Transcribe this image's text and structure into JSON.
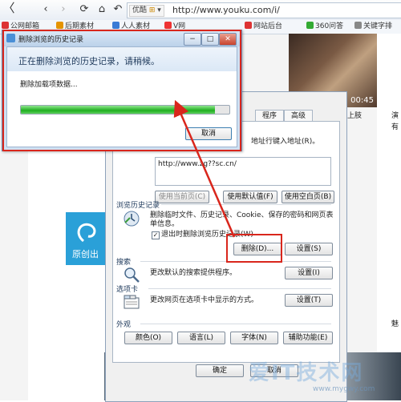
{
  "browser": {
    "youku_label": "优酷",
    "youku_icon": "grid-icon",
    "url": "http://www.youku.com/i/",
    "bookmarks": [
      "公网邮箱",
      "后期素材",
      "人人素材",
      "V网",
      "网站后台",
      "360问答",
      "关键字排"
    ]
  },
  "page": {
    "tile_label": "原创出",
    "video_time": "00:45",
    "side_text_1": "上肢",
    "side_text_2": "演",
    "side_text_3": "有",
    "side_text_4": "魅"
  },
  "options_dialog": {
    "tabs": [
      "程序",
      "高级"
    ],
    "homepage_hint": "地址行键入地址(R)。",
    "homepage_url": "http://www.zg??sc.cn/",
    "btn_use_current": "使用当前页(C)",
    "btn_use_default": "使用默认值(F)",
    "btn_use_blank": "使用空白页(B)",
    "history_section": "浏览历史记录",
    "history_desc": "删除临时文件、历史记录、Cookie、保存的密码和网页表单信息。",
    "history_checkbox": "退出时删除浏览历史记录(W)",
    "btn_delete": "删除(D)...",
    "btn_settings_history": "设置(S)",
    "search_section": "搜索",
    "search_desc": "更改默认的搜索提供程序。",
    "btn_settings_search": "设置(I)",
    "tabs_section": "选项卡",
    "tabs_desc": "更改网页在选项卡中显示的方式。",
    "btn_settings_tabs": "设置(T)",
    "appearance_section": "外观",
    "btn_colors": "颜色(O)",
    "btn_languages": "语言(L)",
    "btn_fonts": "字体(N)",
    "btn_accessibility": "辅助功能(E)",
    "btn_ok": "确定",
    "btn_cancel": "取消"
  },
  "delete_dialog": {
    "title": "删除浏览的历史记录",
    "heading": "正在删除浏览的历史记录，请稍候。",
    "status": "删除加载项数据...",
    "progress": 0.93,
    "btn_cancel": "取消",
    "btn_min": "−",
    "btn_max": "□",
    "btn_close": "✕"
  },
  "watermark": {
    "text": "爱IT技术网",
    "url": "www.mygwy.com"
  },
  "colors": {
    "highlight": "#d9261c",
    "progress": "#1fae1f",
    "tile": "#2aa0d8"
  }
}
